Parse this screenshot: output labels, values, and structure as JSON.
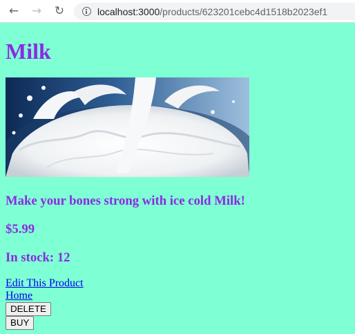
{
  "browser": {
    "url_host": "localhost:3000",
    "url_path": "/products/623201cebc4d1518b2023ef1"
  },
  "product": {
    "name": "Milk",
    "description": "Make your bones strong with ice cold Milk!",
    "price": "$5.99",
    "stock": "In stock: 12"
  },
  "links": {
    "edit": "Edit This Product",
    "home": "Home"
  },
  "buttons": {
    "delete": "DELETE",
    "buy": "BUY"
  },
  "colors": {
    "page_background": "#7fffd4",
    "heading": "#8a2be2",
    "link": "#0000ee"
  }
}
